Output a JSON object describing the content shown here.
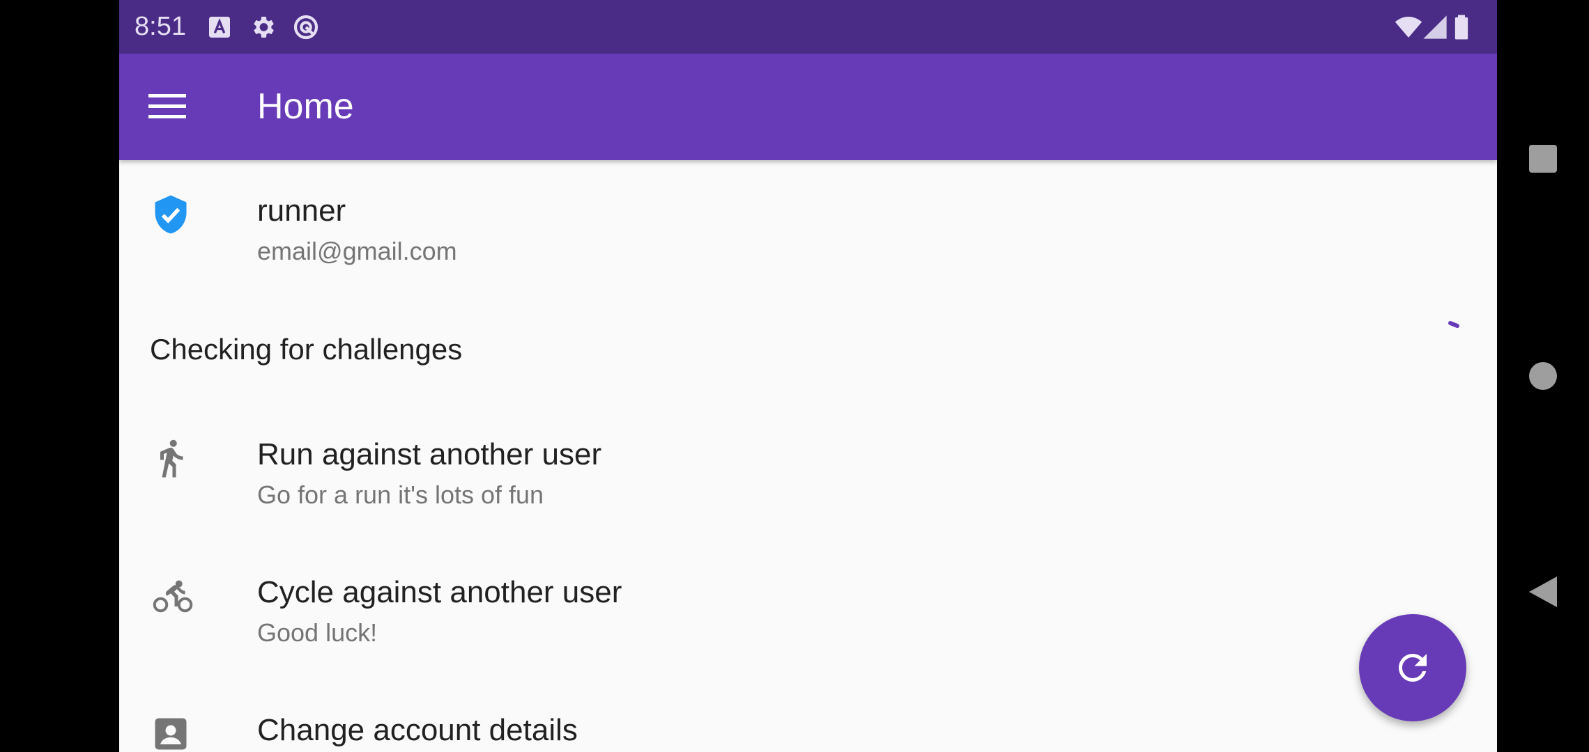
{
  "status_bar": {
    "time": "8:51",
    "icons": [
      "font-icon",
      "settings-icon",
      "sync-icon",
      "wifi-icon",
      "cellular-icon",
      "battery-icon"
    ]
  },
  "app_bar": {
    "title": "Home",
    "menu_icon": "menu-icon"
  },
  "account": {
    "username": "runner",
    "email": "email@gmail.com",
    "icon": "verified-shield-icon"
  },
  "status": {
    "text": "Checking for challenges"
  },
  "options": [
    {
      "title": "Run against another user",
      "subtitle": "Go for a run it's lots of fun",
      "icon": "run-icon"
    },
    {
      "title": "Cycle against another user",
      "subtitle": "Good luck!",
      "icon": "bike-icon"
    },
    {
      "title": "Change account details",
      "icon": "account-box-icon"
    }
  ],
  "fab": {
    "icon": "refresh-icon"
  },
  "colors": {
    "primary": "#673ab7",
    "status_bar": "#4a2c86",
    "verified": "#2196f3",
    "icon_gray": "#757575"
  }
}
